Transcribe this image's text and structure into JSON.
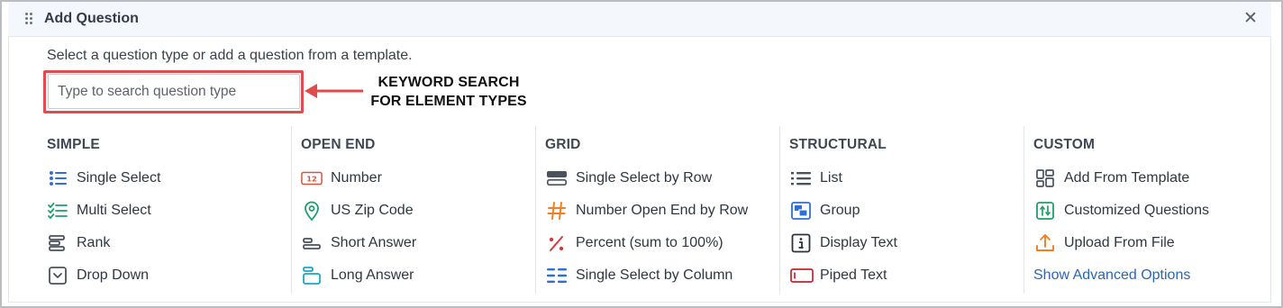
{
  "dialog": {
    "title": "Add Question",
    "instruction": "Select a question type or add a question from a template.",
    "search_placeholder": "Type to search question type"
  },
  "annotation": {
    "line1": "KEYWORD SEARCH",
    "line2": "FOR ELEMENT TYPES",
    "color": "#e04b4f"
  },
  "columns": [
    {
      "heading": "SIMPLE",
      "items": [
        {
          "label": "Single Select",
          "icon": "list-bullet-icon"
        },
        {
          "label": "Multi Select",
          "icon": "checklist-icon"
        },
        {
          "label": "Rank",
          "icon": "rank-bars-icon"
        },
        {
          "label": "Drop Down",
          "icon": "dropdown-box-icon"
        }
      ]
    },
    {
      "heading": "OPEN END",
      "items": [
        {
          "label": "Number",
          "icon": "number-12-icon"
        },
        {
          "label": "US Zip Code",
          "icon": "location-pin-icon"
        },
        {
          "label": "Short Answer",
          "icon": "short-answer-icon"
        },
        {
          "label": "Long Answer",
          "icon": "long-answer-icon"
        }
      ]
    },
    {
      "heading": "GRID",
      "items": [
        {
          "label": "Single Select by Row",
          "icon": "rows-icon"
        },
        {
          "label": "Number Open End by Row",
          "icon": "hash-icon"
        },
        {
          "label": "Percent (sum to 100%)",
          "icon": "percent-icon"
        },
        {
          "label": "Single Select by Column",
          "icon": "columns-icon"
        }
      ]
    },
    {
      "heading": "STRUCTURAL",
      "items": [
        {
          "label": "List",
          "icon": "list-icon"
        },
        {
          "label": "Group",
          "icon": "group-icon"
        },
        {
          "label": "Display Text",
          "icon": "info-icon"
        },
        {
          "label": "Piped Text",
          "icon": "piped-text-icon"
        }
      ]
    },
    {
      "heading": "CUSTOM",
      "items": [
        {
          "label": "Add From Template",
          "icon": "template-grid-icon"
        },
        {
          "label": "Customized Questions",
          "icon": "customized-icon"
        },
        {
          "label": "Upload From File",
          "icon": "upload-icon"
        }
      ],
      "link": "Show Advanced Options"
    }
  ],
  "colors": {
    "blue": "#2f6fd6",
    "green": "#1f9e6b",
    "orange": "#f07f22",
    "red": "#d43a3a",
    "teal": "#1ba6c9",
    "gray": "#4a525e",
    "link": "#2a66b8"
  }
}
